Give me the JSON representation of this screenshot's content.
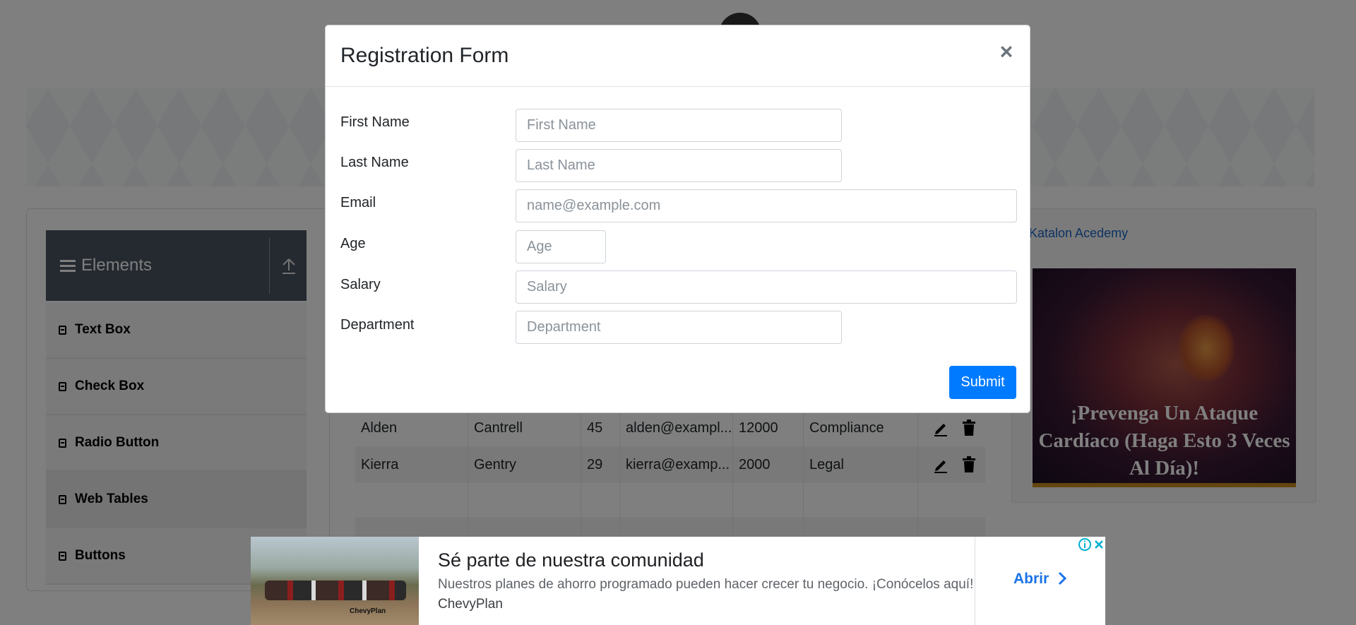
{
  "background": {
    "sidebar": {
      "header_title": "Elements",
      "items": [
        {
          "label": "Text Box"
        },
        {
          "label": "Check Box"
        },
        {
          "label": "Radio Button"
        },
        {
          "label": "Web Tables"
        },
        {
          "label": "Buttons"
        }
      ]
    },
    "table": {
      "rows": [
        [
          "Alden",
          "Cantrell",
          "45",
          "alden@exampl...",
          "12000",
          "Compliance"
        ],
        [
          "Kierra",
          "Gentry",
          "29",
          "kierra@examp...",
          "2000",
          "Legal"
        ]
      ]
    },
    "side_ad": {
      "link_text": "Katalon Acedemy",
      "headline": "¡Prevenga Un Ataque Cardíaco (Haga Esto 3 Veces Al Día)!"
    }
  },
  "modal": {
    "title": "Registration Form",
    "close_label": "×",
    "fields": {
      "first_name": {
        "label": "First Name",
        "placeholder": "First Name",
        "value": ""
      },
      "last_name": {
        "label": "Last Name",
        "placeholder": "Last Name",
        "value": ""
      },
      "email": {
        "label": "Email",
        "placeholder": "name@example.com",
        "value": ""
      },
      "age": {
        "label": "Age",
        "placeholder": "Age",
        "value": ""
      },
      "salary": {
        "label": "Salary",
        "placeholder": "Salary",
        "value": ""
      },
      "department": {
        "label": "Department",
        "placeholder": "Department",
        "value": ""
      }
    },
    "submit_label": "Submit"
  },
  "bottom_ad": {
    "title": "Sé parte de nuestra comunidad",
    "description": "Nuestros planes de ahorro programado pueden hacer crecer tu negocio. ¡Conócelos aquí!",
    "advertiser": "ChevyPlan",
    "cta_label": "Abrir",
    "image_brand": "ChevyPlan"
  },
  "colors": {
    "primary": "#007bff",
    "sidebar_header": "#4b5563",
    "overlay": "rgba(0,0,0,0.5)",
    "ad_link": "#1a73e8"
  }
}
